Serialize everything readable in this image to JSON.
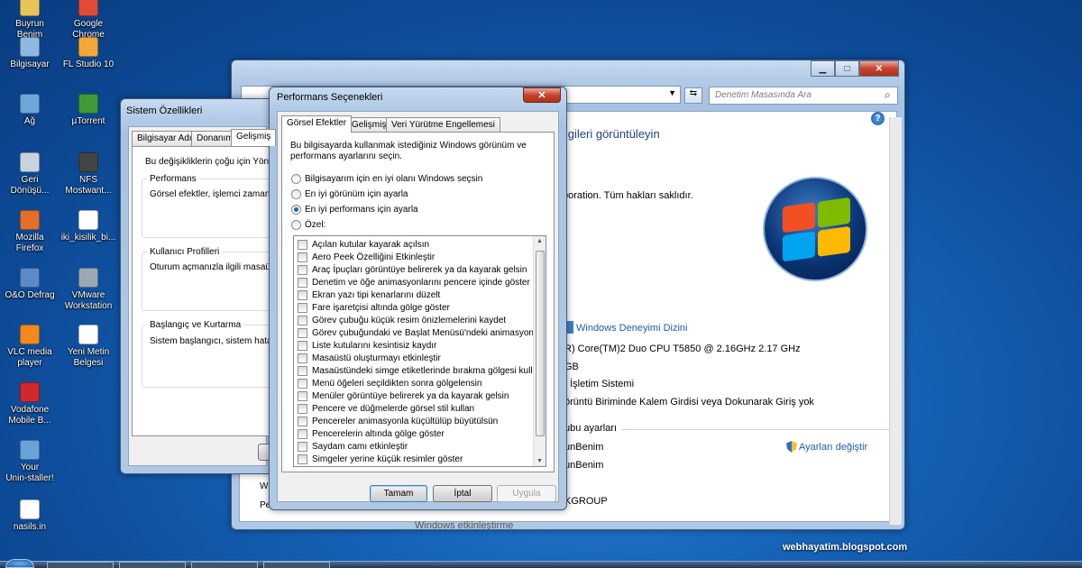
{
  "desktop": {
    "icons": [
      {
        "label": "Buyrun\nBenim",
        "icon": "user-folder-icon",
        "color": "#e7c45a"
      },
      {
        "label": "Google\nChrome",
        "icon": "chrome-icon",
        "color": "#e04b3a"
      },
      {
        "label": "Bilgisayar",
        "icon": "computer-icon",
        "color": "#8fb8e0"
      },
      {
        "label": "FL Studio 10",
        "icon": "fl-studio-icon",
        "color": "#f2a73b"
      },
      {
        "label": "Ağ",
        "icon": "network-icon",
        "color": "#6ea6d9"
      },
      {
        "label": "µTorrent",
        "icon": "utorrent-icon",
        "color": "#3f9b3a"
      },
      {
        "label": "Geri\nDönüşü...",
        "icon": "recycle-bin-icon",
        "color": "#c7d3df"
      },
      {
        "label": "NFS\nMostwant...",
        "icon": "nfs-icon",
        "color": "#444444"
      },
      {
        "label": "Mozilla\nFirefox",
        "icon": "firefox-icon",
        "color": "#e2702b"
      },
      {
        "label": "iki_kisilik_bi...",
        "icon": "document-icon",
        "color": "#ffffff"
      },
      {
        "label": "O&O Defrag",
        "icon": "defrag-icon",
        "color": "#5b8bc7"
      },
      {
        "label": "VMware\nWorkstation",
        "icon": "vmware-icon",
        "color": "#9aa8b5"
      },
      {
        "label": "VLC media\nplayer",
        "icon": "vlc-icon",
        "color": "#f08a1c"
      },
      {
        "label": "Yeni Metin\nBelgesi",
        "icon": "text-file-icon",
        "color": "#ffffff"
      },
      {
        "label": "Vodafone\nMobile B...",
        "icon": "vodafone-icon",
        "color": "#d0282c"
      },
      {
        "label": "Your\nUnin-staller!",
        "icon": "uninstaller-icon",
        "color": "#6aa3d8"
      },
      {
        "label": "nasils.in",
        "icon": "document-icon",
        "color": "#ffffff"
      }
    ],
    "watermark": "webhayatim.blogspot.com"
  },
  "control_panel": {
    "search_placeholder": "Denetim Masasında Ara",
    "heading_fragment": "ilgileri görüntüleyin",
    "copyright_fragment": "poration. Tüm hakları saklıdır.",
    "rating_link": "Windows Deneyimi Dizini",
    "processor": "R) Core(TM)2 Duo CPU     T5850  @ 2.16GHz   2.17 GHz",
    "memory": "GB",
    "system_type": "t İşletim Sistemi",
    "pen_touch": "örüntü Biriminde Kalem Girdisi veya Dokunarak Giriş yok",
    "section_fragment": "ubu ayarları",
    "computer_name": "unBenim",
    "full_name": "unBenim",
    "workgroup": "KGROUP",
    "change_settings": "Ayarları değiştir",
    "bottom_fragment": "Windows etkinleştirme"
  },
  "system_properties": {
    "title": "Sistem Özellikleri",
    "tabs": [
      "Bilgisayar Adı",
      "Donanım",
      "Gelişmiş"
    ],
    "intro": "Bu değişikliklerin çoğu için Yönetic",
    "groups": [
      {
        "label": "Performans",
        "text": "Görsel efektler, işlemci zamanlar"
      },
      {
        "label": "Kullanıcı Profilleri",
        "text": "Oturum açmanızla ilgili masaüstü"
      },
      {
        "label": "Başlangıç ve Kurtarma",
        "text": "Sistem başlangıcı, sistem hatası"
      }
    ],
    "side_fragments": [
      "Wi",
      "Pe"
    ]
  },
  "performance_options": {
    "title": "Performans Seçenekleri",
    "close_label": "✕",
    "tabs": [
      "Görsel Efektler",
      "Gelişmiş",
      "Veri Yürütme Engellemesi"
    ],
    "description": "Bu bilgisayarda kullanmak istediğiniz Windows görünüm ve performans ayarlarını seçin.",
    "radios": [
      {
        "label": "Bilgisayarım için en iyi olanı Windows seçsin",
        "selected": false
      },
      {
        "label": "En iyi görünüm için ayarla",
        "selected": false
      },
      {
        "label": "En iyi performans için ayarla",
        "selected": true
      },
      {
        "label": "Özel:",
        "selected": false
      }
    ],
    "effects": [
      "Açılan kutular kayarak açılsın",
      "Aero Peek Özelliğini Etkinleştir",
      "Araç İpuçları görüntüye belirerek ya da kayarak gelsin",
      "Denetim ve öğe animasyonlarını pencere içinde göster",
      "Ekran yazı tipi kenarlarını düzelt",
      "Fare işaretçisi altında gölge göster",
      "Görev çubuğu küçük resim önizlemelerini kaydet",
      "Görev çubuğundaki ve Başlat Menüsü'ndeki animasyonlar",
      "Liste kutularını kesintisiz kaydır",
      "Masaüstü oluşturmayı etkinleştir",
      "Masaüstündeki simge etiketlerinde bırakma gölgesi kullan",
      "Menü öğeleri seçildikten sonra gölgelensin",
      "Menüler görüntüye belirerek ya da kayarak gelsin",
      "Pencere ve düğmelerde görsel stil kullan",
      "Pencereler animasyonla küçültülüp büyütülsün",
      "Pencerelerin altında gölge göster",
      "Saydam camı etkinleştir",
      "Simgeler yerine küçük resimler göster"
    ],
    "buttons": {
      "ok": "Tamam",
      "cancel": "İptal",
      "apply": "Uygula"
    }
  }
}
